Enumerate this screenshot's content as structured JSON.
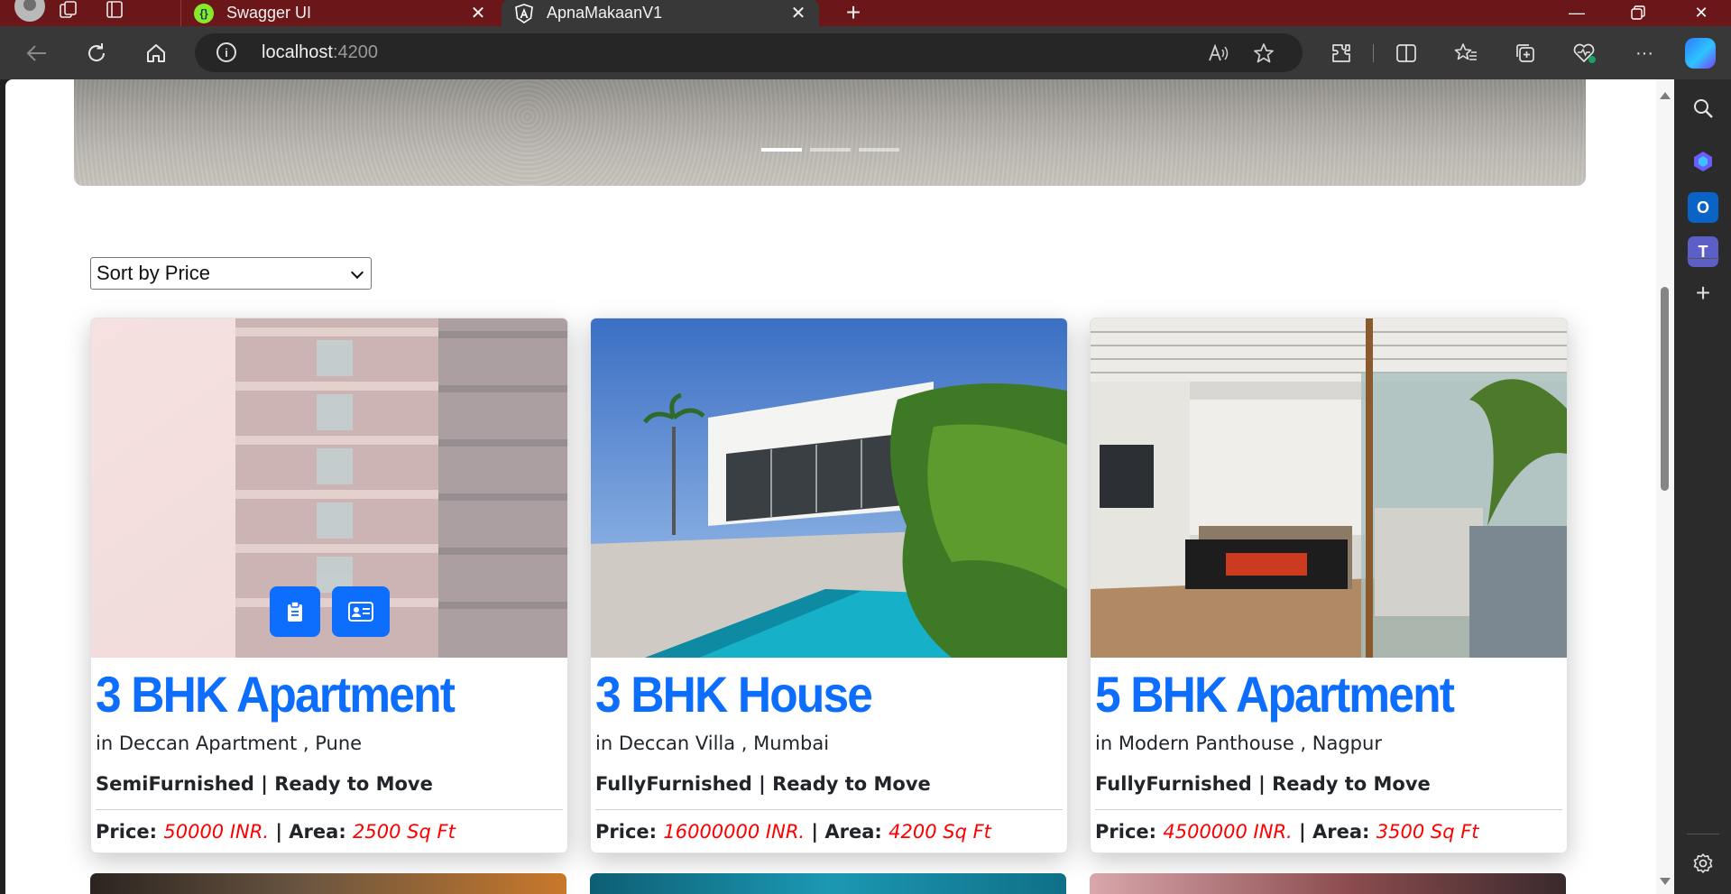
{
  "browser": {
    "tabs": [
      {
        "title": "Swagger UI",
        "favicon": "swagger-icon"
      },
      {
        "title": "ApnaMakaanV1",
        "favicon": "angular-icon"
      }
    ],
    "address": {
      "host": "localhost",
      "port": ":4200"
    }
  },
  "page": {
    "sort": {
      "selected": "Sort by Price"
    },
    "listings": [
      {
        "title": "3 BHK Apartment",
        "location": "in Deccan Apartment , Pune",
        "status": "SemiFurnished | Ready to Move",
        "price_label": "Price:",
        "price": "50000 INR.",
        "area_label": "| Area:",
        "area": "2500 Sq Ft"
      },
      {
        "title": "3 BHK House",
        "location": "in Deccan Villa , Mumbai",
        "status": "FullyFurnished | Ready to Move",
        "price_label": "Price:",
        "price": "16000000 INR.",
        "area_label": "| Area:",
        "area": "4200 Sq Ft"
      },
      {
        "title": "5 BHK Apartment",
        "location": "in Modern Panthouse , Nagpur",
        "status": "FullyFurnished | Ready to Move",
        "price_label": "Price:",
        "price": "4500000 INR.",
        "area_label": "| Area:",
        "area": "3500 Sq Ft"
      }
    ]
  },
  "colors": {
    "titlebar": "#6b1618",
    "accent": "#0d6efd",
    "price": "#ff0000"
  }
}
